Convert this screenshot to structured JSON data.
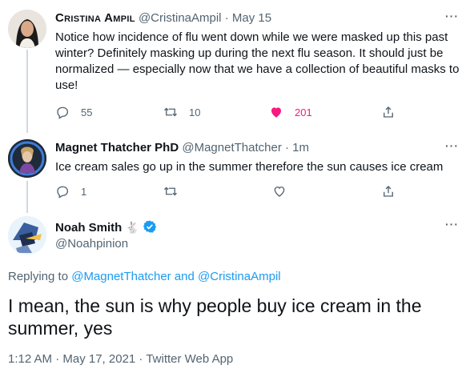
{
  "tweets": [
    {
      "display_name": "Cristina Ampil",
      "handle": "@CristinaAmpil",
      "separator": "·",
      "time": "May 15",
      "text": "Notice how incidence of flu went down while we were masked up this past winter? Definitely masking up during the next flu season. It should just be normalized — especially now that we have a collection of beautiful masks to use!",
      "replies": "55",
      "retweets": "10",
      "likes": "201",
      "liked": true
    },
    {
      "display_name": "Magnet Thatcher PhD",
      "handle": "@MagnetThatcher",
      "separator": "·",
      "time": "1m",
      "text": "Ice cream sales go up in the summer therefore the sun causes ice cream",
      "replies": "1",
      "retweets": "",
      "likes": "",
      "liked": false
    }
  ],
  "main_tweet": {
    "display_name": "Noah Smith",
    "emoji": "🐇",
    "handle": "@Noahpinion",
    "replying_prefix": "Replying to",
    "replying_user1": "@MagnetThatcher",
    "replying_and": "and",
    "replying_user2": "@CristinaAmpil",
    "text": "I mean, the sun is why people buy ice cream in the summer, yes",
    "timestamp": "1:12 AM · May 17, 2021 · Twitter Web App"
  },
  "colors": {
    "accent": "#1d9bf0",
    "like": "#f91880",
    "muted": "#536471",
    "thread_line": "#cfd9de"
  },
  "icons": [
    "reply-icon",
    "retweet-icon",
    "like-icon",
    "share-icon",
    "more-icon",
    "verified-icon"
  ]
}
